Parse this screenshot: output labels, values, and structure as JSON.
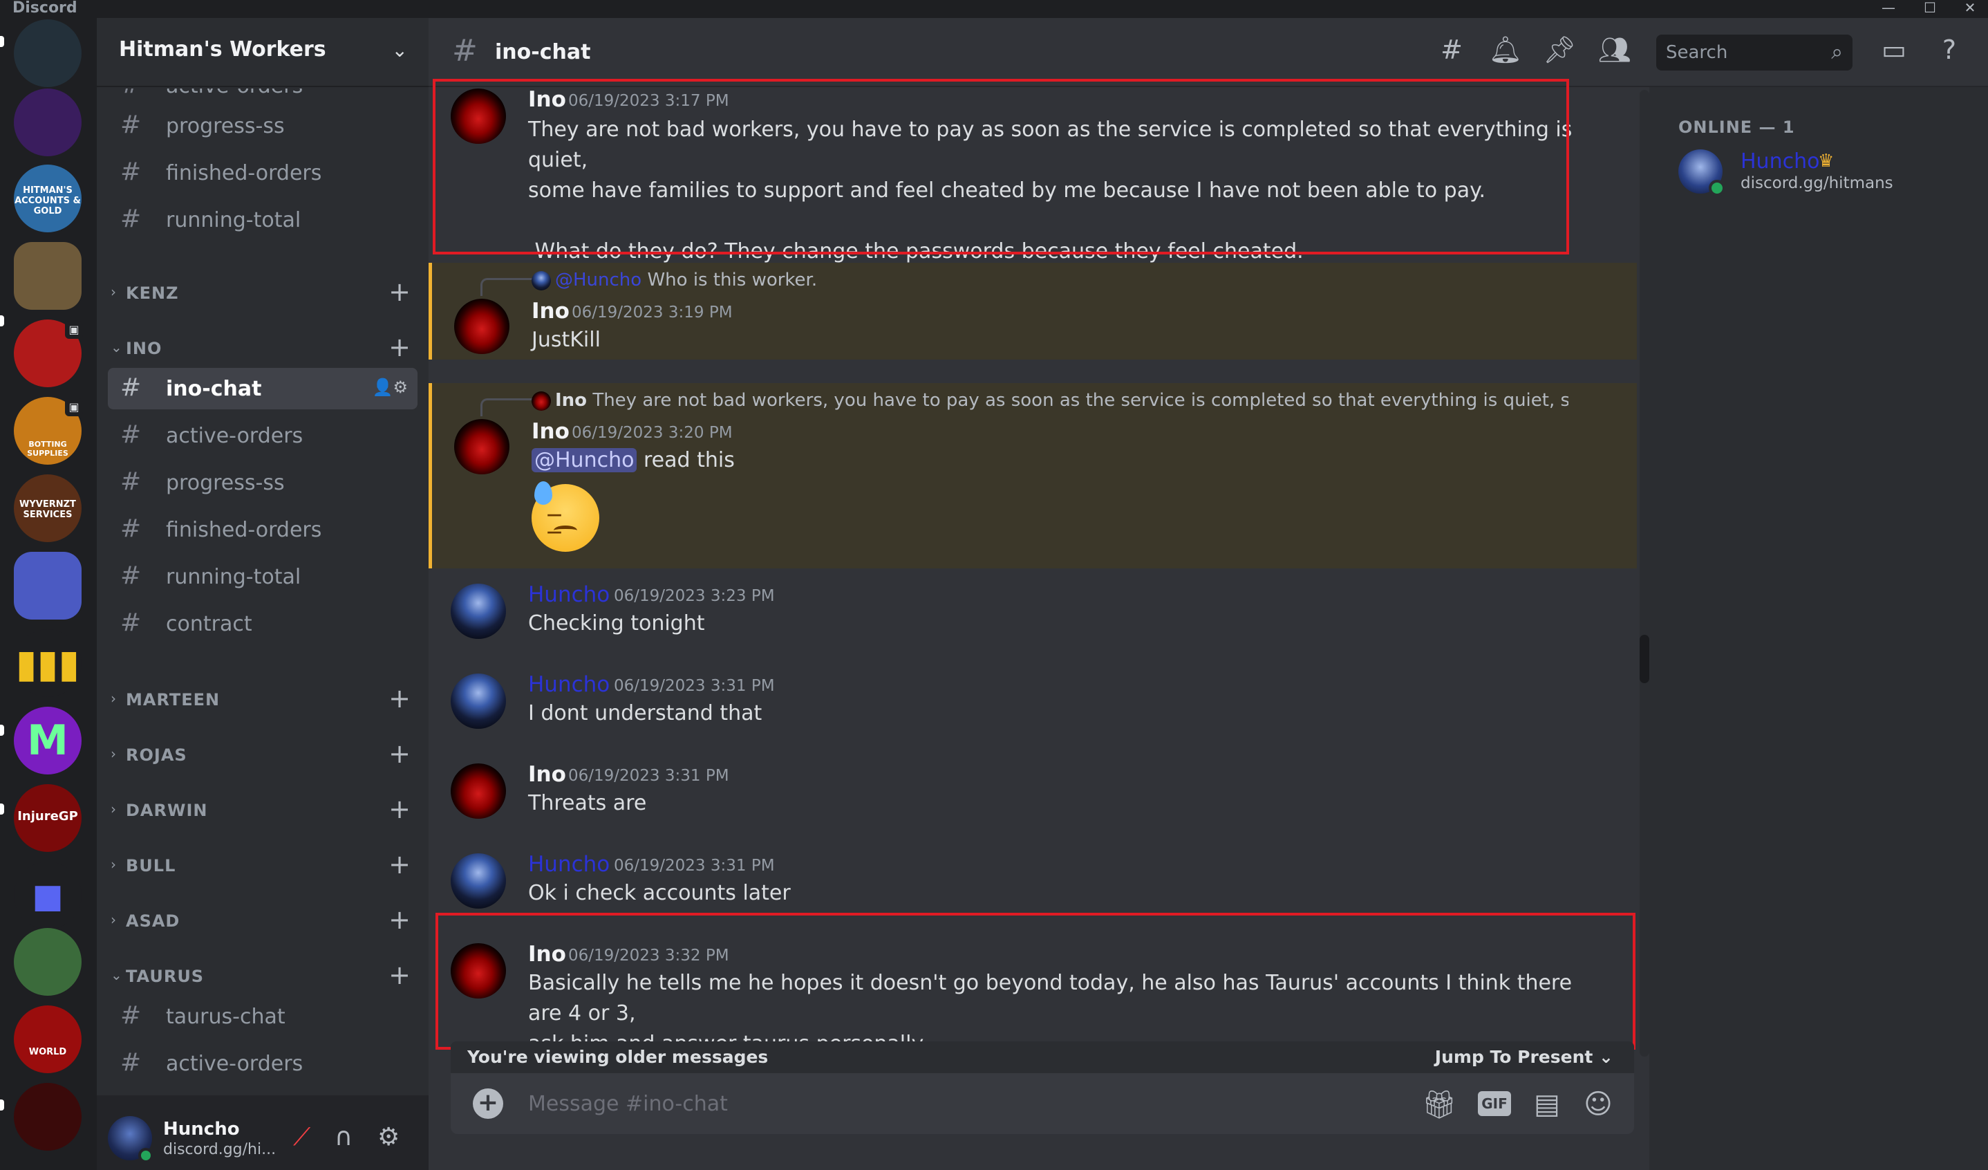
{
  "app": {
    "brand": "Discord",
    "minimize": "—",
    "maximize": "☐",
    "close": "✕"
  },
  "servers": [
    {
      "label": "",
      "color": "#23303a"
    },
    {
      "label": "",
      "color": "#3a1d5e"
    },
    {
      "label": "HITMAN'S ACCOUNTS & GOLD",
      "color": "#2d6ca5"
    },
    {
      "label": "",
      "color": "#6e5a3a"
    },
    {
      "label": "",
      "color": "#b01a1a"
    },
    {
      "label": "BOTTING SUPPLIES",
      "color": "#c77a18"
    },
    {
      "label": "WYVERNZT SERVICES",
      "color": "#5a2f18"
    },
    {
      "label": "",
      "color": "#4b5ac2"
    },
    {
      "label": "",
      "color": "#1e1f22"
    },
    {
      "label": "M",
      "color": "#7a1ec0"
    },
    {
      "label": "InjureGP",
      "color": "#7a0a0a"
    },
    {
      "label": "",
      "color": "#1e1f22"
    },
    {
      "label": "",
      "color": "#3b6b3b"
    },
    {
      "label": "WORLD",
      "color": "#9a0d0d"
    },
    {
      "label": "",
      "color": "#3a0a0a"
    }
  ],
  "guild": {
    "name": "Hitman's Workers",
    "chevron": "⌄"
  },
  "channels": {
    "top": [
      "active-orders",
      "progress-ss",
      "finished-orders",
      "running-total"
    ],
    "cat_kenz": "KENZ",
    "cat_ino": "INO",
    "ino": [
      "ino-chat",
      "active-orders",
      "progress-ss",
      "finished-orders",
      "running-total",
      "contract"
    ],
    "cats": [
      "MARTEEN",
      "ROJAS",
      "DARWIN",
      "BULL",
      "ASAD"
    ],
    "cat_taurus": "TAURUS",
    "taurus": [
      "taurus-chat",
      "active-orders"
    ]
  },
  "user": {
    "name": "Huncho",
    "status": "discord.gg/hi..."
  },
  "header": {
    "channel": "ino-chat",
    "search_placeholder": "Search"
  },
  "messages": [
    {
      "author": "Ino",
      "time": "06/19/2023 3:17 PM",
      "text": "They are not bad workers, you have to pay as soon as the service is completed so that everything is quiet,\nsome have families to support and feel cheated by me because I have not been able to pay.\n\n What do they do? They change the passwords because they feel cheated."
    },
    {
      "reply_name": "@Huncho",
      "reply_text": "Who is this worker.",
      "author": "Ino",
      "time": "06/19/2023 3:19 PM",
      "text": "JustKill"
    },
    {
      "reply_name": "Ino",
      "reply_text": "They are not bad workers, you have to pay as soon as the service is completed so that everything is quiet, some have fam",
      "author": "Ino",
      "time": "06/19/2023 3:20 PM",
      "mention": "@Huncho",
      "text": " read this"
    },
    {
      "author": "Huncho",
      "time": "06/19/2023 3:23 PM",
      "text": "Checking tonight"
    },
    {
      "author": "Huncho",
      "time": "06/19/2023 3:31 PM",
      "text": "I dont understand that"
    },
    {
      "author": "Ino",
      "time": "06/19/2023 3:31 PM",
      "text": "Threats are"
    },
    {
      "author": "Huncho",
      "time": "06/19/2023 3:31 PM",
      "text": "Ok i check accounts later"
    },
    {
      "author": "Ino",
      "time": "06/19/2023 3:32 PM",
      "text": "Basically he tells me he hopes it doesn't go beyond today, he also has Taurus' accounts I think there are 4 or 3,\nask him and answer taurus personally..."
    }
  ],
  "older_bar": {
    "left": "You're viewing older messages",
    "right": "Jump To Present ⌄"
  },
  "composer": {
    "placeholder": "Message #ino-chat",
    "gif": "GIF"
  },
  "members": {
    "section": "ONLINE — 1",
    "name": "Huncho",
    "status": "discord.gg/hitmans"
  },
  "colors": {
    "highlight": "#f0b232",
    "annotation_box": "#e01b24",
    "username_blue": "#2b33d6"
  }
}
